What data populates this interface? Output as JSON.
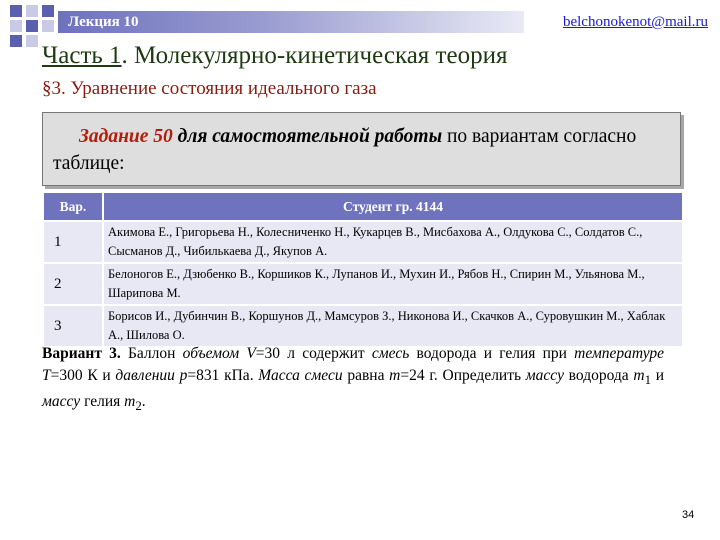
{
  "header": {
    "lecture": "Лекция 10",
    "email": "belchonokenot@mail.ru"
  },
  "title": {
    "part": "Часть 1",
    "rest": ". Молекулярно-кинетическая теория"
  },
  "subtitle": "§3. Уравнение состояния идеального газа",
  "task": {
    "label": "Задание 50",
    "emph": "для самостоятельной работы",
    "rest": " по вариантам согласно таблице:"
  },
  "table": {
    "headers": [
      "Вар.",
      "Студент гр. 4144"
    ],
    "rows": [
      {
        "num": "1",
        "names": "Акимова Е., Григорьева Н., Колесниченко Н., Кукарцев В., Мисбахова А., Олдукова С., Солдатов С., Сысманов Д., Чибилькаева Д., Якупов А."
      },
      {
        "num": "2",
        "names": "Белоногов Е., Дзюбенко В., Коршиков К., Лупанов И., Мухин И., Рябов Н., Спирин М., Ульянова М., Шарипова М."
      },
      {
        "num": "3",
        "names": "Борисов И., Дубинчин В., Коршунов Д., Мамсуров З., Никонова И., Скачков А., Суровушкин М., Хаблак А., Шилова О."
      }
    ]
  },
  "problem": {
    "label": "Вариант 3.",
    "t1": " Баллон ",
    "volume_word": "объемом",
    "volume_sym": "V",
    "t2": "=30 л содержит ",
    "mixture_word": "смесь",
    "t3": " водорода и гелия при ",
    "temp_word": "температуре",
    "temp_sym": "T",
    "t4": "=300 К и ",
    "pressure_word": "давлении",
    "pressure_sym": "p",
    "t5": "=831 кПа. ",
    "mass_mix": "Масса смеси",
    "t6": " равна ",
    "mass_sym": "m",
    "t7": "=24 г. Определить ",
    "mass_word1": "массу",
    "t8": " водорода ",
    "m1_sym": "m",
    "m1_sub": "1",
    "t9": " и ",
    "mass_word2": "массу",
    "t10": " гелия ",
    "m2_sym": "m",
    "m2_sub": "2",
    "t11": "."
  },
  "page_number": "34"
}
